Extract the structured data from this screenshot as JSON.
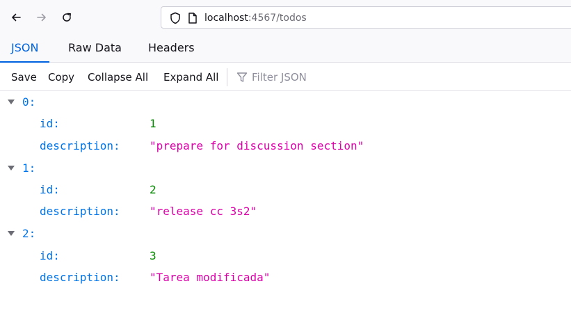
{
  "browser": {
    "url_host": "localhost",
    "url_rest": ":4567/todos"
  },
  "viewer": {
    "tabs": [
      "JSON",
      "Raw Data",
      "Headers"
    ],
    "selected_tab": "JSON"
  },
  "toolbar": {
    "save_label": "Save",
    "copy_label": "Copy",
    "collapse_label": "Collapse All",
    "expand_label": "Expand All",
    "filter_placeholder": "Filter JSON"
  },
  "todos": [
    {
      "index": "0:",
      "id_key": "id:",
      "id": "1",
      "desc_key": "description:",
      "description": "\"prepare for discussion section\""
    },
    {
      "index": "1:",
      "id_key": "id:",
      "id": "2",
      "desc_key": "description:",
      "description": "\"release cc 3s2\""
    },
    {
      "index": "2:",
      "id_key": "id:",
      "id": "3",
      "desc_key": "description:",
      "description": "\"Tarea modificada\""
    }
  ],
  "colors": {
    "accent": "#0062dc",
    "key": "#0074e8",
    "number": "#058b00",
    "string": "#dd00a9"
  }
}
